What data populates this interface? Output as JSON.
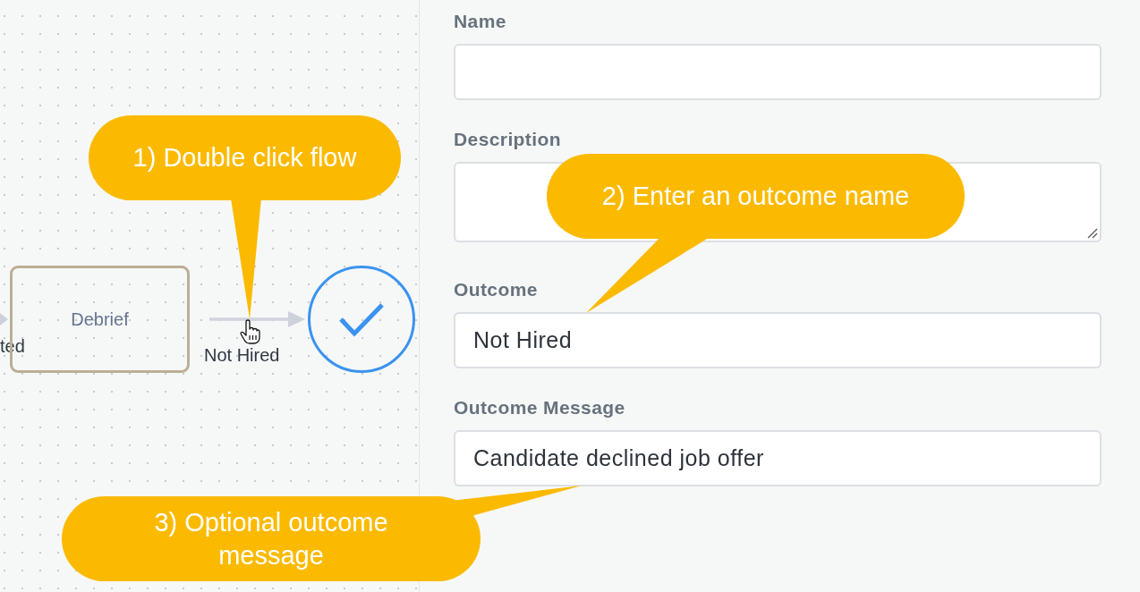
{
  "canvas": {
    "edges": [
      {
        "label": "ted"
      },
      {
        "label": "Not Hired"
      }
    ],
    "nodes": [
      {
        "kind": "task",
        "label": "Debrief"
      },
      {
        "kind": "end"
      }
    ]
  },
  "form": {
    "fields": [
      {
        "kind": "input",
        "label": "Name"
      },
      {
        "kind": "textarea",
        "label": "Description"
      },
      {
        "kind": "input",
        "label": "Outcome",
        "value": "Not Hired"
      },
      {
        "kind": "input",
        "label": "Outcome Message",
        "value": "Candidate declined job offer"
      }
    ]
  },
  "callouts": [
    {
      "text": "1) Double click flow"
    },
    {
      "text": "2) Enter an outcome name"
    },
    {
      "text": "3) Optional outcome message"
    }
  ]
}
